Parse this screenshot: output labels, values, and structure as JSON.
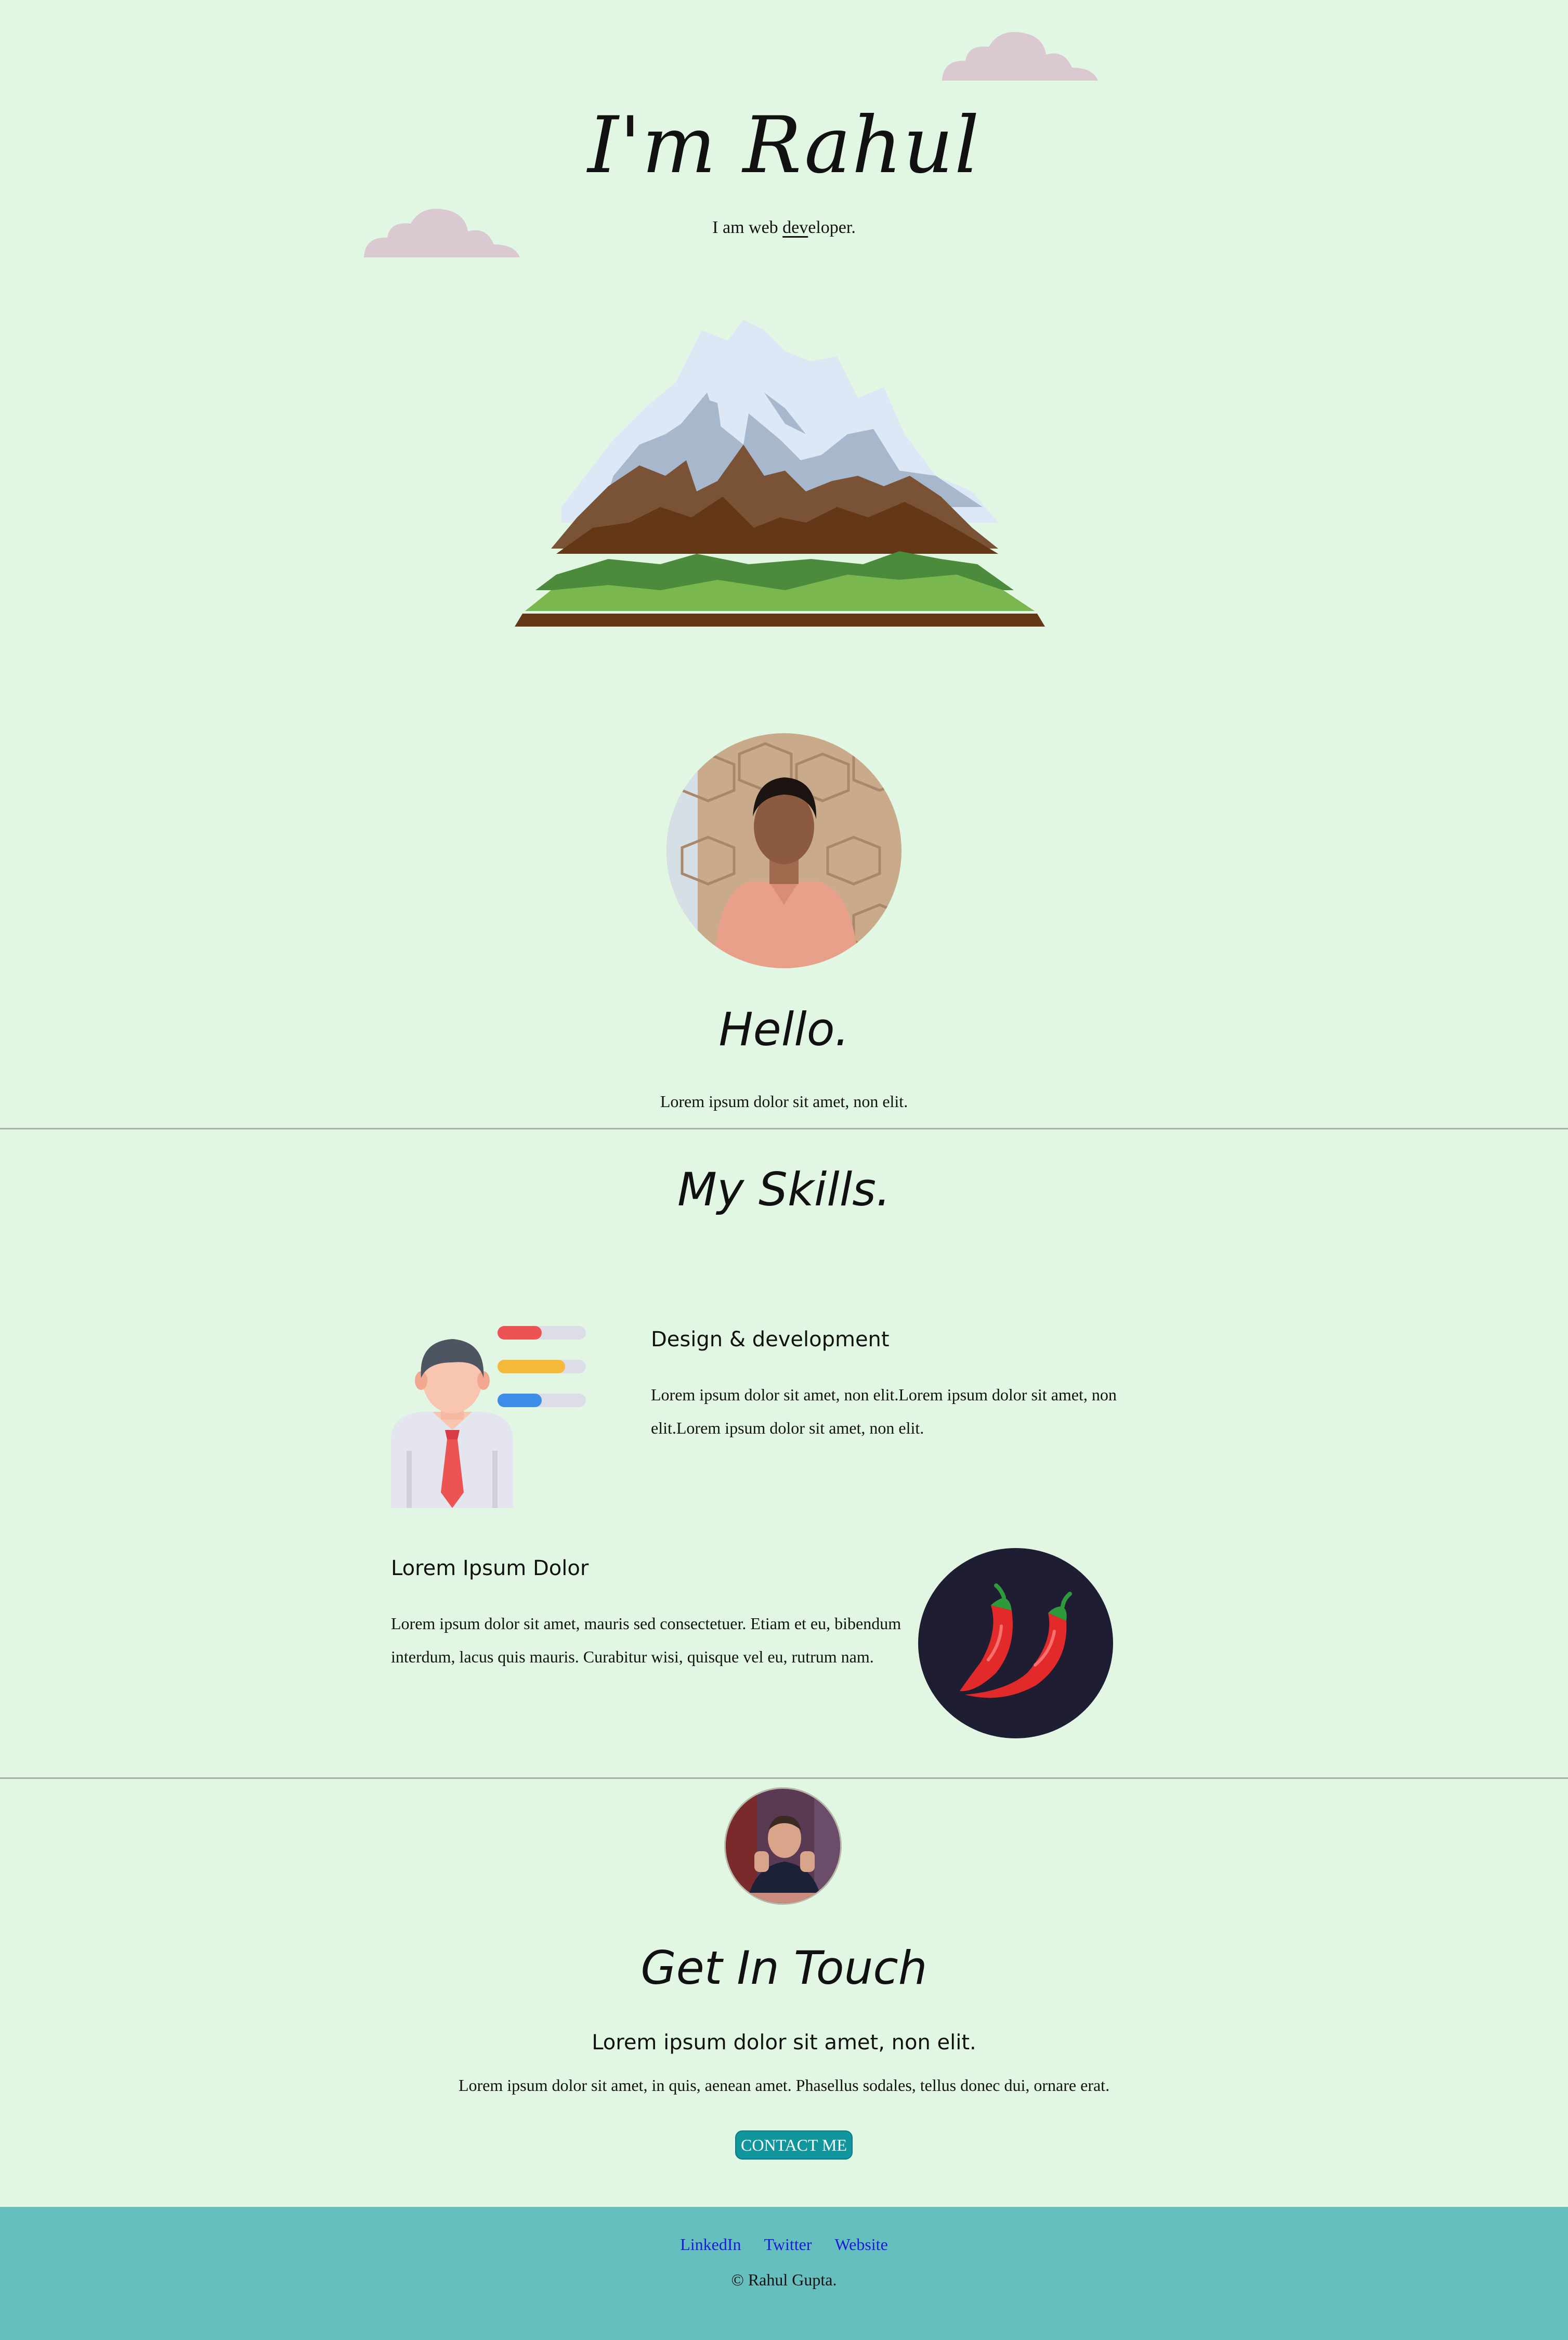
{
  "hero": {
    "title": "I'm Rahul",
    "subtitle_before": "I am web ",
    "subtitle_underlined": "dev",
    "subtitle_after": "eloper."
  },
  "about": {
    "heading": "Hello.",
    "text": "Lorem ipsum dolor sit amet, non elit."
  },
  "skills": {
    "heading": "My Skills.",
    "items": [
      {
        "title": "Design & development",
        "text": "Lorem ipsum dolor sit amet, non elit.Lorem ipsum dolor sit amet, non elit.Lorem ipsum dolor sit amet, non elit."
      },
      {
        "title": "Lorem Ipsum Dolor",
        "text": "Lorem ipsum dolor sit amet, mauris sed consectetuer. Etiam et eu, bibendum interdum, lacus quis mauris. Curabitur wisi, quisque vel eu, rutrum nam."
      }
    ]
  },
  "contact": {
    "heading": "Get In Touch",
    "subheading": "Lorem ipsum dolor sit amet, non elit.",
    "text": "Lorem ipsum dolor sit amet, in quis, aenean amet. Phasellus sodales, tellus donec dui, ornare erat.",
    "button_label": "CONTACT ME"
  },
  "footer": {
    "links": [
      "LinkedIn",
      "Twitter",
      "Website"
    ],
    "copyright": "© Rahul Gupta."
  },
  "colors": {
    "background": "#e2f7e3",
    "footer": "#66bfbf",
    "button": "#11969e",
    "cloud": "#dbc9d1",
    "link": "#1b1bd6"
  },
  "icons": [
    "cloud-icon",
    "mountain-illustration",
    "profile-photo",
    "skills-person-illustration",
    "chili-illustration",
    "contact-avatar"
  ]
}
